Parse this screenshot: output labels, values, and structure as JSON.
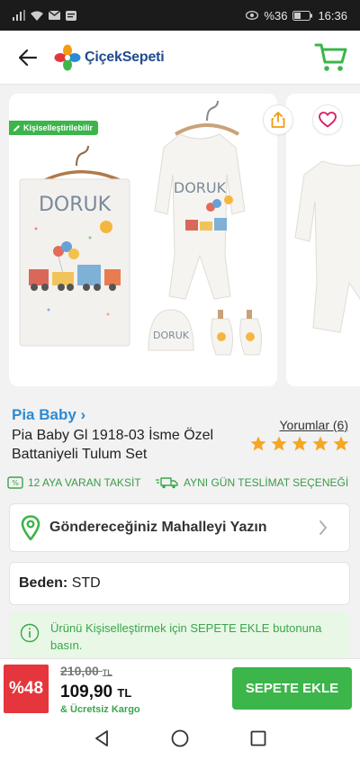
{
  "status_bar": {
    "left_icons": [
      "signal-icon",
      "wifi-icon",
      "mail-icon",
      "message-icon"
    ],
    "battery": "%36",
    "time": "16:36"
  },
  "header": {
    "logo_text": "ÇiçekSepeti"
  },
  "gallery": {
    "badge": "Kişiselleştirilebilir",
    "blanket_name": "DORUK",
    "bodysuit_name": "DORUK",
    "hat_name": "DORUK"
  },
  "product": {
    "brand": "Pia Baby",
    "brand_chevron": "›",
    "title": "Pia Baby Gl 1918-03 İsme Özel Battaniyeli Tulum Set",
    "reviews": "Yorumlar (6)",
    "rating": 5,
    "features": [
      {
        "icon": "installment-icon",
        "label": "12 AYA VARAN TAKSİT"
      },
      {
        "icon": "delivery-truck-icon",
        "label": "AYNI GÜN TESLİMAT SEÇENEĞİ"
      }
    ]
  },
  "address": {
    "label": "Göndereceğiniz Mahalleyi Yazın"
  },
  "size": {
    "label": "Beden:",
    "value": "STD"
  },
  "notice": {
    "text": "Ürünü Kişiselleştirmek için SEPETE EKLE butonuna basın."
  },
  "purchase": {
    "discount": "%48",
    "old_price": "210,00",
    "new_price": "109,90",
    "currency": "TL",
    "shipping": "& Ücretsiz Kargo",
    "cta": "SEPETE EKLE"
  },
  "colors": {
    "brand_green": "#3cb54a",
    "brand_blue": "#2a8bd6",
    "discount_red": "#e5363d",
    "star": "#f5a623"
  }
}
